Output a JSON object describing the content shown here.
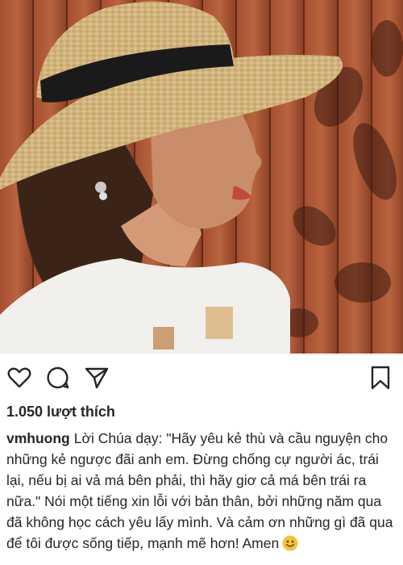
{
  "post": {
    "photo_alt": "woman-in-straw-hat-photo",
    "likes_text": "1.050 lượt thích",
    "username": "vmhuong",
    "caption": "Lời Chúa dạy: \"Hãy yêu kẻ thù và cầu nguyện cho những kẻ ngược đãi anh em. Đừng chống cự người ác, trái lại, nếu bị ai vả má bên phải, thì hãy giơ cả má bên trái ra nữa.\" Nói một tiếng xin lỗi với bản thân, bởi những năm qua đã không học cách yêu lấy mình. Và cảm ơn những gì đã qua để tôi được sống tiếp, mạnh mẽ hơn! Amen"
  },
  "icons": {
    "like": "heart-icon",
    "comment": "comment-icon",
    "share": "share-icon",
    "save": "bookmark-icon",
    "emoji": "smiley-emoji-icon"
  },
  "colors": {
    "text": "#262626",
    "background": "#ffffff",
    "emoji": "#f5c33b"
  }
}
